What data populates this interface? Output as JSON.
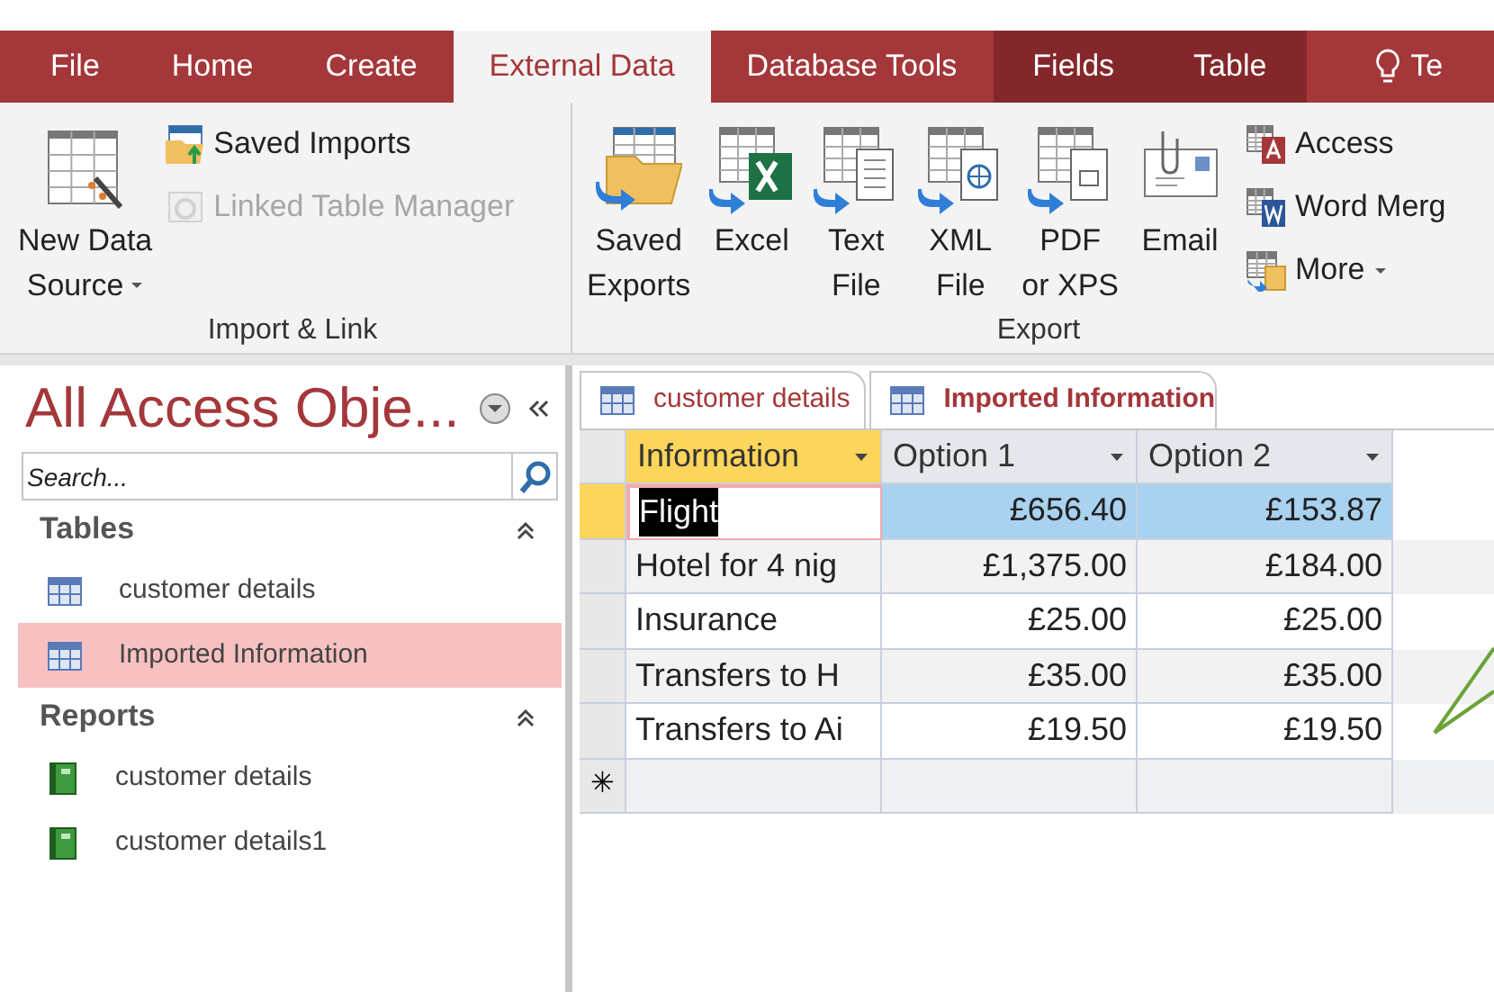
{
  "ribbon_tabs": [
    {
      "label": "File",
      "kind": "tab",
      "selected": false
    },
    {
      "label": "Home",
      "kind": "tab",
      "selected": false
    },
    {
      "label": "Create",
      "kind": "tab",
      "selected": false
    },
    {
      "label": "External Data",
      "kind": "tab",
      "selected": true
    },
    {
      "label": "Database Tools",
      "kind": "tab",
      "selected": false
    },
    {
      "label": "Fields",
      "kind": "context",
      "selected": false
    },
    {
      "label": "Table",
      "kind": "context",
      "selected": false
    },
    {
      "label": "Te",
      "kind": "tellme",
      "selected": false
    }
  ],
  "ribbon_groups": [
    {
      "label": "Import & Link",
      "large_buttons": [
        {
          "lines": [
            "New Data",
            "Source"
          ],
          "dropdown": true
        }
      ],
      "small_buttons": [
        {
          "label": "Saved Imports",
          "disabled": false,
          "dropdown": false
        },
        {
          "label": "Linked Table Manager",
          "disabled": true,
          "dropdown": false
        }
      ]
    },
    {
      "label": "Export",
      "large_buttons": [
        {
          "lines": [
            "Saved",
            "Exports"
          ],
          "dropdown": false
        },
        {
          "lines": [
            "Excel"
          ],
          "dropdown": false
        },
        {
          "lines": [
            "Text",
            "File"
          ],
          "dropdown": false
        },
        {
          "lines": [
            "XML",
            "File"
          ],
          "dropdown": false
        },
        {
          "lines": [
            "PDF",
            "or XPS"
          ],
          "dropdown": false
        },
        {
          "lines": [
            "Email"
          ],
          "dropdown": false
        }
      ],
      "small_buttons": [
        {
          "label": "Access",
          "disabled": false,
          "dropdown": false
        },
        {
          "label": "Word Merg",
          "disabled": false,
          "dropdown": false
        },
        {
          "label": "More",
          "disabled": false,
          "dropdown": true
        }
      ]
    }
  ],
  "navigation_pane": {
    "title": "All Access Obje...",
    "search": {
      "placeholder": "Search..."
    },
    "groups": [
      {
        "label": "Tables",
        "kind": "table",
        "items": [
          {
            "label": "customer details",
            "selected": false
          },
          {
            "label": "Imported Information",
            "selected": true
          }
        ]
      },
      {
        "label": "Reports",
        "kind": "report",
        "items": [
          {
            "label": "customer details",
            "selected": false
          },
          {
            "label": "customer details1",
            "selected": false
          }
        ]
      }
    ]
  },
  "document_tabs": [
    {
      "label": "customer details",
      "selected": false
    },
    {
      "label": "Imported Information",
      "selected": true
    }
  ],
  "table": {
    "columns": [
      {
        "label": "Information",
        "selected": true
      },
      {
        "label": "Option 1",
        "selected": false
      },
      {
        "label": "Option 2",
        "selected": false
      }
    ],
    "rows": [
      {
        "selected": true,
        "cells": [
          {
            "text": "Flight",
            "editing": true
          },
          {
            "text": "£656.40",
            "editing": false
          },
          {
            "text": "£153.87",
            "editing": false
          }
        ]
      },
      {
        "selected": false,
        "cells": [
          {
            "text": "Hotel for 4 nig",
            "editing": false
          },
          {
            "text": "£1,375.00",
            "editing": false
          },
          {
            "text": "£184.00",
            "editing": false
          }
        ]
      },
      {
        "selected": false,
        "cells": [
          {
            "text": "Insurance",
            "editing": false
          },
          {
            "text": "£25.00",
            "editing": false
          },
          {
            "text": "£25.00",
            "editing": false
          }
        ]
      },
      {
        "selected": false,
        "cells": [
          {
            "text": "Transfers to H",
            "editing": false
          },
          {
            "text": "£35.00",
            "editing": false
          },
          {
            "text": "£35.00",
            "editing": false
          }
        ]
      },
      {
        "selected": false,
        "cells": [
          {
            "text": "Transfers to Ai",
            "editing": false
          },
          {
            "text": "£19.50",
            "editing": false
          },
          {
            "text": "£19.50",
            "editing": false
          }
        ]
      }
    ],
    "new_record_marker": "✳"
  }
}
